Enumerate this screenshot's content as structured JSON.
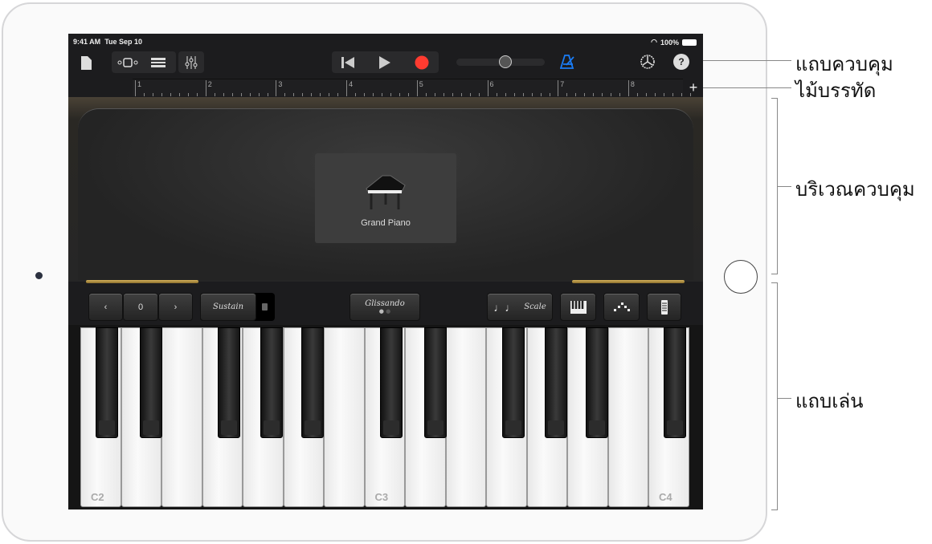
{
  "status": {
    "time": "9:41 AM",
    "date": "Tue Sep 10",
    "battery": "100%"
  },
  "toolbar": {
    "icons": [
      "document-icon",
      "view-icon",
      "tracks-icon",
      "mixer-icon",
      "rewind-icon",
      "play-icon",
      "record-icon",
      "metronome-icon",
      "settings-icon",
      "help-icon"
    ],
    "help_glyph": "?",
    "record_color": "#ff3b30",
    "metronome_color": "#1a7cf5",
    "volume": 0.55
  },
  "ruler": {
    "bars": [
      "1",
      "2",
      "3",
      "4",
      "5",
      "6",
      "7",
      "8"
    ],
    "add": "+"
  },
  "instrument": {
    "name": "Grand Piano"
  },
  "controls": {
    "octave_value": "0",
    "prev": "‹",
    "next": "›",
    "sustain": "Sustain",
    "glissando": "Glissando",
    "scale": "Scale",
    "notes_glyph": "♩♩"
  },
  "keyboard": {
    "labels": {
      "c2": "C2",
      "c3": "C3",
      "c4": "C4"
    }
  },
  "callouts": {
    "control_bar": "แถบควบคุม",
    "ruler": "ไม้บรรทัด",
    "controls_area": "บริเวณควบคุม",
    "play_area": "แถบเล่น"
  }
}
